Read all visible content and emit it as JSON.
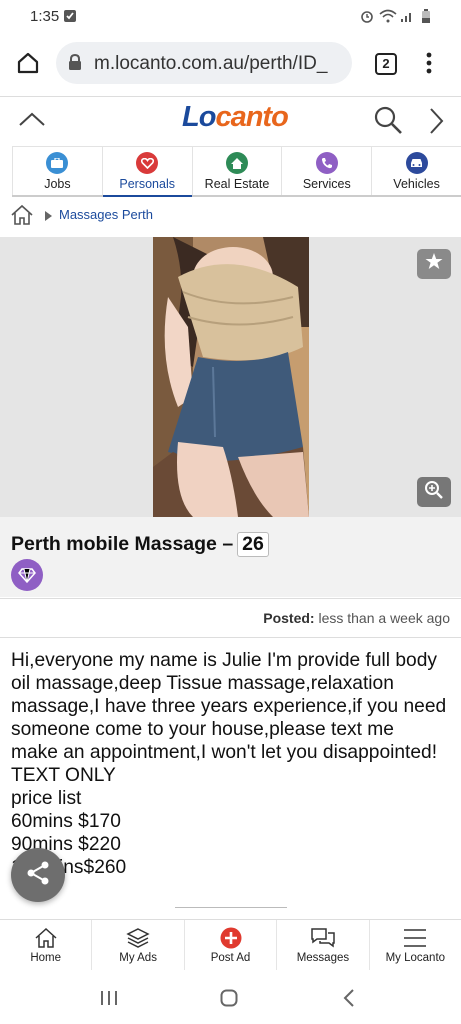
{
  "status_bar": {
    "time": "1:35"
  },
  "browser": {
    "url": "m.locanto.com.au/perth/ID_",
    "tab_count": "2"
  },
  "site": {
    "logo_lo": "Lo",
    "logo_canto": "canto"
  },
  "categories": [
    {
      "label": "Jobs",
      "color": "#3a8fd4"
    },
    {
      "label": "Personals",
      "color": "#d93a3a"
    },
    {
      "label": "Real Estate",
      "color": "#2e8b57"
    },
    {
      "label": "Services",
      "color": "#8f5fc4"
    },
    {
      "label": "Vehicles",
      "color": "#2d4a9c"
    }
  ],
  "breadcrumb": {
    "item": "Massages Perth"
  },
  "listing": {
    "title": "Perth mobile Massage –",
    "age": "26",
    "posted_label": "Posted:",
    "posted_value": "less than a week ago",
    "description_lines": [
      "Hi,everyone my name is Julie I'm provide full body",
      "oil massage,deep Tissue massage,relaxation",
      "massage,I have three years experience,if you need",
      "someone come to your house,please text me",
      "make an appointment,I won't let you disappointed!",
      "TEXT ONLY",
      "price list",
      "60mins $170",
      "90mins $220",
      "120mins$260"
    ]
  },
  "bottom_nav": [
    {
      "label": "Home"
    },
    {
      "label": "My Ads"
    },
    {
      "label": "Post Ad"
    },
    {
      "label": "Messages"
    },
    {
      "label": "My Locanto"
    }
  ],
  "colors": {
    "brand_blue": "#1b4a9c",
    "brand_orange": "#e8661c",
    "post_red": "#e03a2f"
  }
}
